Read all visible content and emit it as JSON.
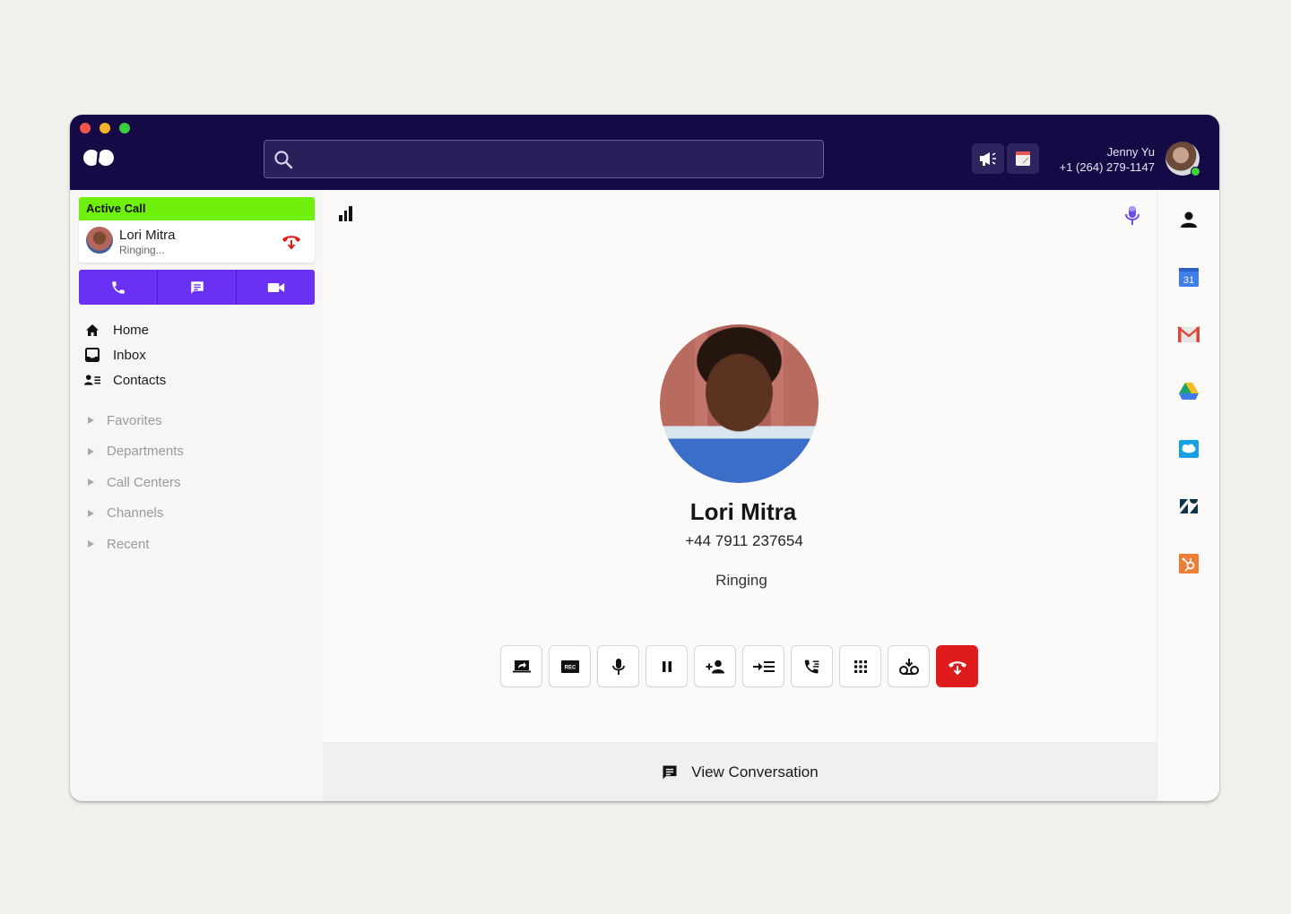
{
  "window": {
    "controls": [
      "close",
      "minimize",
      "maximize"
    ]
  },
  "header": {
    "logo": "dialpad-logo",
    "search": {
      "value": "",
      "placeholder": ""
    },
    "buttons": [
      {
        "name": "announcement",
        "icon": "megaphone-icon"
      },
      {
        "name": "calendar",
        "icon": "calendar-icon"
      }
    ],
    "user": {
      "name": "Jenny Yu",
      "phone": "+1 (264) 279-1147",
      "presence": "online"
    }
  },
  "sidebar": {
    "active_call": {
      "title": "Active Call",
      "contact_name": "Lori Mitra",
      "status": "Ringing...",
      "actions": [
        {
          "name": "call",
          "icon": "phone-icon"
        },
        {
          "name": "message",
          "icon": "message-icon"
        },
        {
          "name": "video",
          "icon": "video-icon"
        }
      ]
    },
    "nav": [
      {
        "label": "Home",
        "icon": "home-icon"
      },
      {
        "label": "Inbox",
        "icon": "inbox-icon"
      },
      {
        "label": "Contacts",
        "icon": "contacts-icon"
      }
    ],
    "groups": [
      {
        "label": "Favorites"
      },
      {
        "label": "Departments"
      },
      {
        "label": "Call Centers"
      },
      {
        "label": "Channels"
      },
      {
        "label": "Recent"
      }
    ]
  },
  "call": {
    "contact_name": "Lori Mitra",
    "phone": "+44 7911 237654",
    "status": "Ringing",
    "controls": [
      {
        "name": "share-screen",
        "icon": "screen-share-icon"
      },
      {
        "name": "record",
        "icon": "record-icon",
        "label": "REC"
      },
      {
        "name": "mute",
        "icon": "microphone-icon"
      },
      {
        "name": "hold",
        "icon": "pause-icon"
      },
      {
        "name": "add-participant",
        "icon": "add-person-icon"
      },
      {
        "name": "transfer",
        "icon": "transfer-icon"
      },
      {
        "name": "call-queue",
        "icon": "phone-list-icon"
      },
      {
        "name": "keypad",
        "icon": "keypad-icon"
      },
      {
        "name": "voicemail-drop",
        "icon": "voicemail-icon"
      },
      {
        "name": "hang-up",
        "icon": "hang-up-icon"
      }
    ],
    "view_conversation": "View Conversation"
  },
  "integrations": [
    {
      "name": "contact",
      "icon": "person-icon"
    },
    {
      "name": "google-calendar",
      "icon": "google-calendar-icon",
      "label": "31"
    },
    {
      "name": "gmail",
      "icon": "gmail-icon"
    },
    {
      "name": "google-drive",
      "icon": "google-drive-icon"
    },
    {
      "name": "salesforce",
      "icon": "salesforce-icon"
    },
    {
      "name": "zendesk",
      "icon": "zendesk-icon"
    },
    {
      "name": "hubspot",
      "icon": "hubspot-icon"
    }
  ],
  "colors": {
    "header_bg": "#150a45",
    "active_call": "#6ef00a",
    "action_bar": "#6a31f5",
    "hang_up": "#e01b1b",
    "mic_indicator": "#6a4cf0"
  }
}
